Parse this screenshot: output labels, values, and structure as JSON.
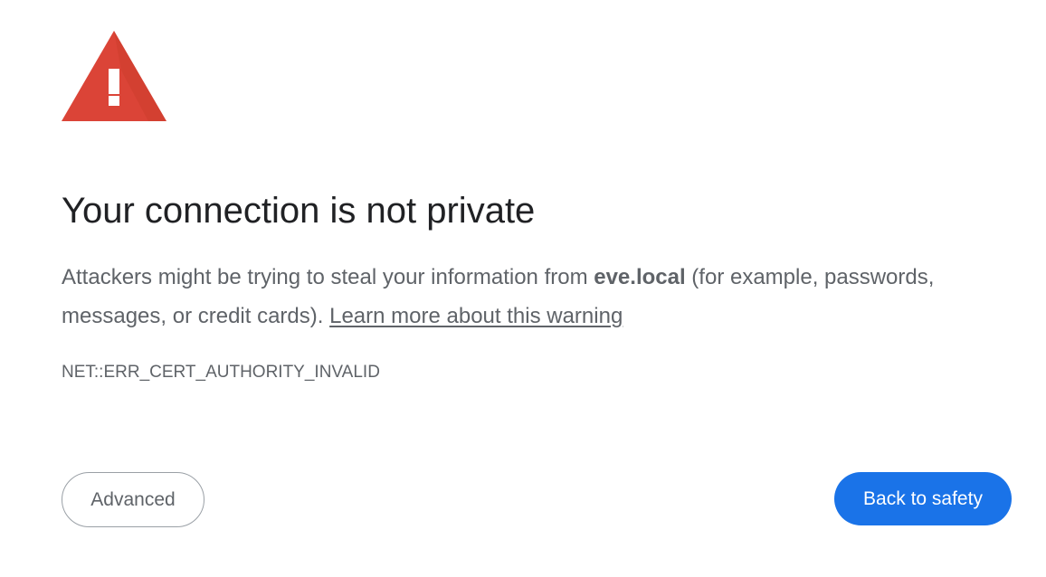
{
  "icon": {
    "name": "warning-triangle-icon",
    "color": "#db4437",
    "mark_color": "#ffffff"
  },
  "heading": "Your connection is not private",
  "message": {
    "before_host": "Attackers might be trying to steal your information from ",
    "host": "eve.local",
    "after_host": " (for example, passwords, messages, or credit cards). ",
    "learn_more": "Learn more about this warning"
  },
  "error_code": "NET::ERR_CERT_AUTHORITY_INVALID",
  "buttons": {
    "advanced": "Advanced",
    "back_to_safety": "Back to safety"
  },
  "colors": {
    "primary_button": "#1a73e8",
    "text_dark": "#202124",
    "text_muted": "#5f6368"
  }
}
